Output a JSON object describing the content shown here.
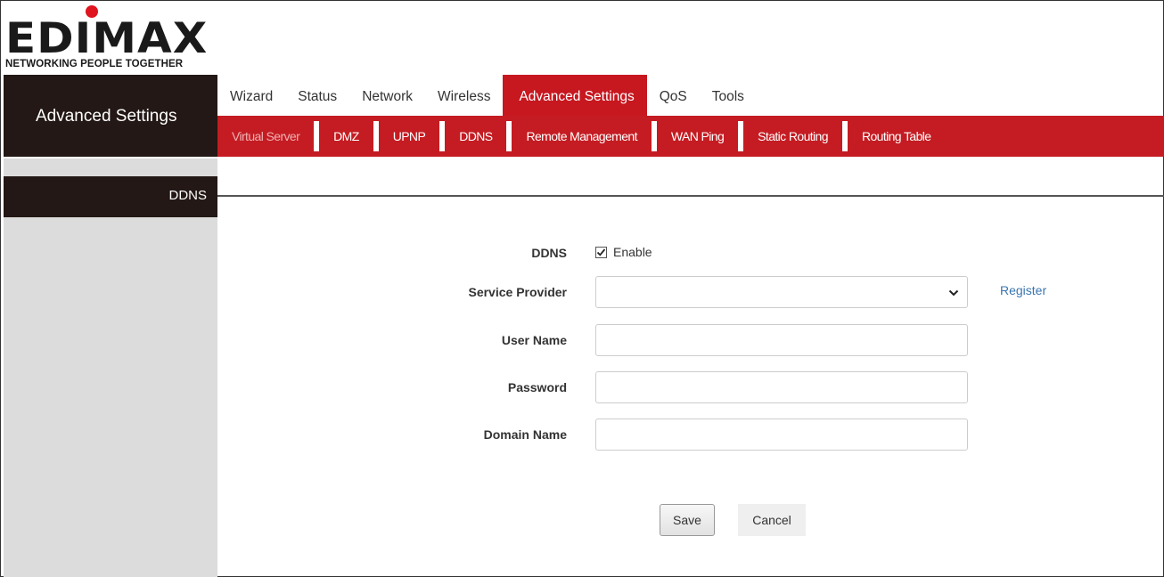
{
  "logo": {
    "wordmark": "EDIMAX",
    "tagline": "NETWORKING PEOPLE TOGETHER",
    "dot_color": "#e0141e"
  },
  "sidebar": {
    "title": "Advanced Settings",
    "items": [
      {
        "label": "DDNS"
      }
    ]
  },
  "top_nav": {
    "tabs": [
      {
        "label": "Wizard"
      },
      {
        "label": "Status"
      },
      {
        "label": "Network"
      },
      {
        "label": "Wireless"
      },
      {
        "label": "Advanced Settings",
        "active": true
      },
      {
        "label": "QoS"
      },
      {
        "label": "Tools"
      }
    ]
  },
  "sub_nav": {
    "tabs": [
      {
        "label": "Virtual Server"
      },
      {
        "label": "DMZ"
      },
      {
        "label": "UPNP"
      },
      {
        "label": "DDNS",
        "active": true
      },
      {
        "label": "Remote Management"
      },
      {
        "label": "WAN Ping"
      },
      {
        "label": "Static Routing"
      },
      {
        "label": "Routing Table"
      }
    ]
  },
  "form": {
    "ddns_label": "DDNS",
    "enable_label": "Enable",
    "enable_checked": true,
    "service_provider_label": "Service Provider",
    "service_provider_value": "",
    "register_link": "Register",
    "username_label": "User Name",
    "username_value": "",
    "password_label": "Password",
    "password_value": "",
    "domain_label": "Domain Name",
    "domain_value": "",
    "save_label": "Save",
    "cancel_label": "Cancel"
  },
  "colors": {
    "accent": "#c41c22",
    "sidebar_dark": "#231815",
    "link": "#3a76b0"
  }
}
